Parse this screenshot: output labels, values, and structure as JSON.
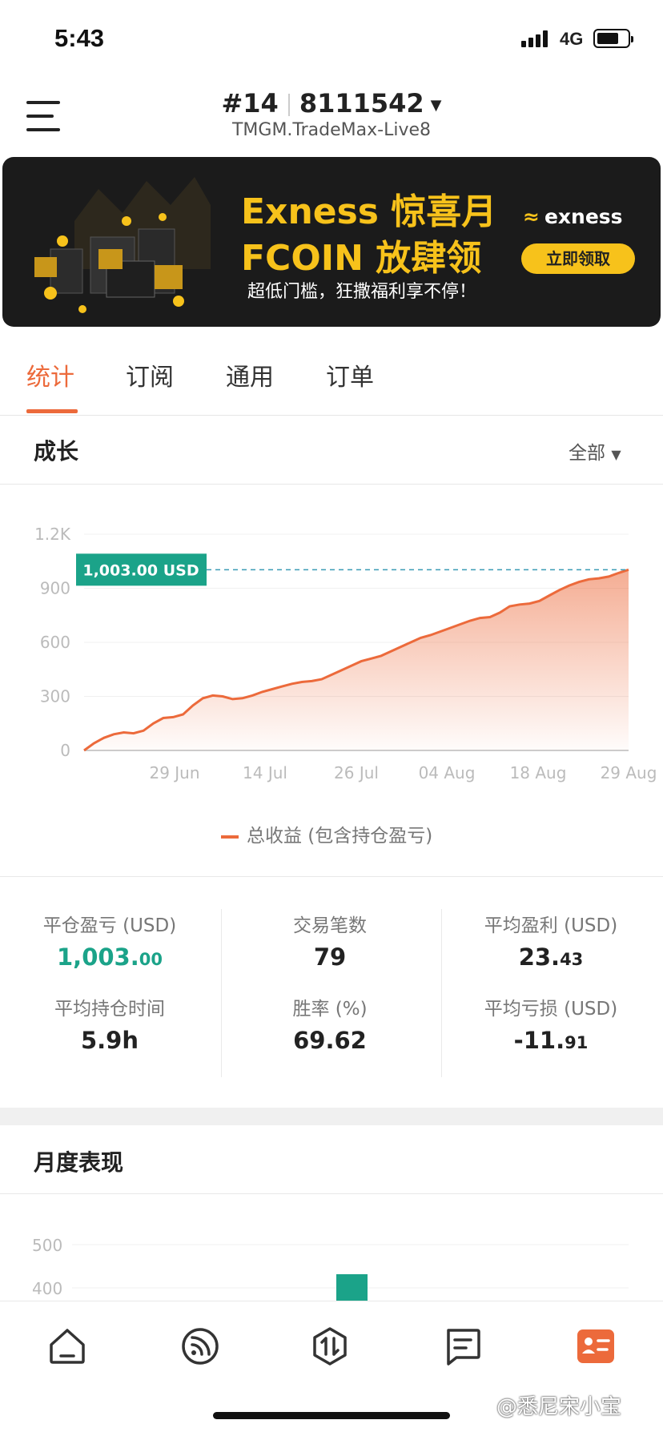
{
  "status_bar": {
    "time": "5:43",
    "network": "4G"
  },
  "header": {
    "account_number": "#14",
    "account_id": "8111542",
    "server": "TMGM.TradeMax-Live8"
  },
  "banner": {
    "line1": "Exness 惊喜月",
    "line2": "FCOIN 放肆领",
    "line3": "超低门槛，狂撒福利享不停！",
    "brand": "exness",
    "cta": "立即领取"
  },
  "tabs": [
    {
      "label": "统计",
      "active": true
    },
    {
      "label": "订阅",
      "active": false
    },
    {
      "label": "通用",
      "active": false
    },
    {
      "label": "订单",
      "active": false
    }
  ],
  "growth": {
    "title": "成长",
    "filter": "全部",
    "legend": "总收益 (包含持仓盈亏)"
  },
  "chart_data": {
    "type": "area",
    "y_ticks": [
      "1.2K",
      "900",
      "600",
      "300",
      "0"
    ],
    "ylim": [
      0,
      1200
    ],
    "x_ticks": [
      "29 Jun",
      "14 Jul",
      "26 Jul",
      "04 Aug",
      "18 Aug",
      "29 Aug"
    ],
    "current_label": "1,003.00 USD",
    "current_value": 1003,
    "color": "#ec6a3b",
    "series": [
      {
        "values": [
          0,
          40,
          70,
          90,
          100,
          95,
          110,
          150,
          180,
          185,
          200,
          250,
          290,
          305,
          300,
          285,
          290,
          305,
          325,
          340,
          355,
          370,
          380,
          385,
          395,
          420,
          445,
          470,
          495,
          510,
          525,
          550,
          575,
          600,
          625,
          640,
          660,
          680,
          700,
          720,
          735,
          740,
          765,
          800,
          810,
          815,
          830,
          860,
          890,
          915,
          935,
          950,
          955,
          965,
          985,
          1003
        ]
      }
    ]
  },
  "stats": [
    {
      "label": "平仓盈亏 (USD)",
      "main": "1,003.",
      "dec": "00",
      "green": true
    },
    {
      "label": "交易笔数",
      "main": "79",
      "dec": "",
      "green": false
    },
    {
      "label": "平均盈利 (USD)",
      "main": "23.",
      "dec": "43",
      "green": false
    },
    {
      "label": "平均持仓时间",
      "main": "5.9h",
      "dec": "",
      "green": false
    },
    {
      "label": "胜率 (%)",
      "main": "69.62",
      "dec": "",
      "green": false
    },
    {
      "label": "平均亏损 (USD)",
      "main": "-11.",
      "dec": "91",
      "green": false
    }
  ],
  "monthly": {
    "title": "月度表现",
    "chart_data": {
      "type": "bar",
      "y_ticks": [
        "500",
        "400"
      ],
      "color": "#1ba389"
    }
  },
  "watermark": "@悉尼宋小宝"
}
